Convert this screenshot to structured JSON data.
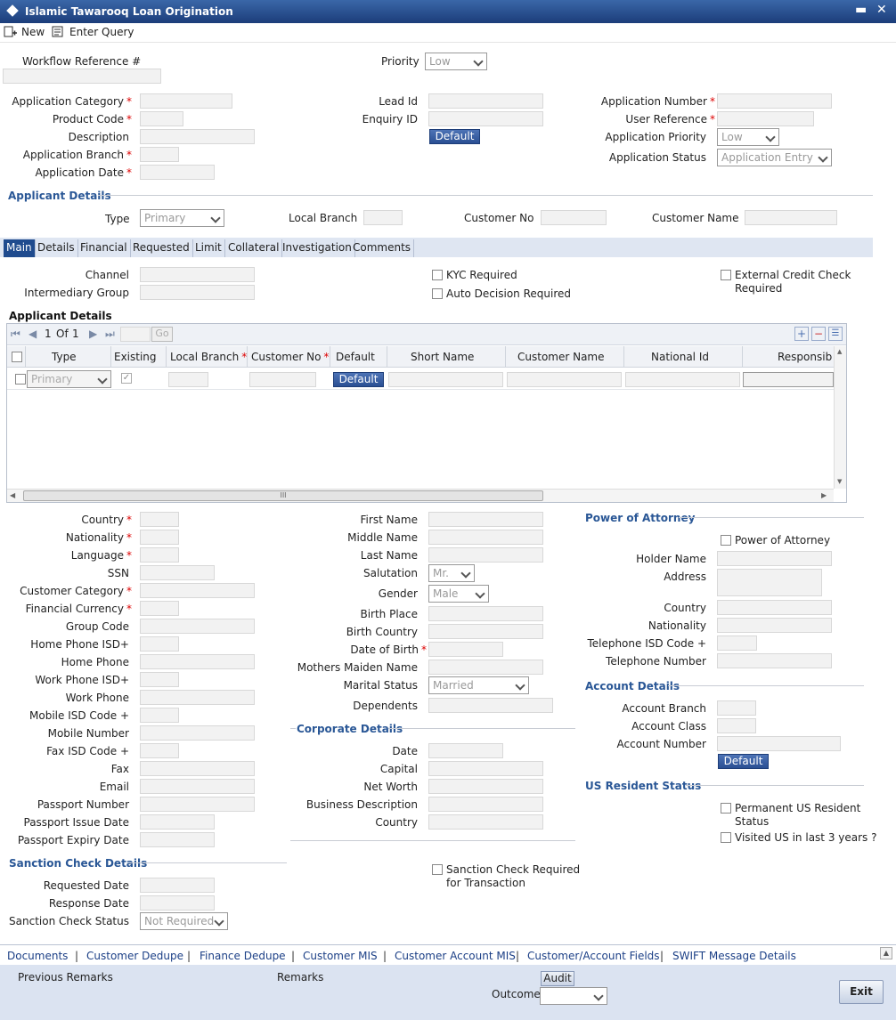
{
  "window": {
    "title": "Islamic Tawarooq Loan Origination",
    "min": "▬",
    "close": "✕"
  },
  "toolbar": {
    "new": "New",
    "enter_query": "Enter Query"
  },
  "header": {
    "workflow_ref": "Workflow Reference #",
    "priority": "Priority",
    "priority_val": "Low",
    "app_category": "Application Category",
    "product_code": "Product Code",
    "description": "Description",
    "app_branch": "Application Branch",
    "app_date": "Application Date",
    "lead_id": "Lead Id",
    "enquiry_id": "Enquiry ID",
    "default_btn": "Default",
    "app_number": "Application Number",
    "user_ref": "User Reference",
    "app_priority": "Application Priority",
    "app_priority_val": "Low",
    "app_status": "Application Status",
    "app_status_val": "Application Entry"
  },
  "applicant": {
    "section": "Applicant Details",
    "type": "Type",
    "type_val": "Primary",
    "local_branch": "Local Branch",
    "customer_no": "Customer No",
    "customer_name": "Customer Name"
  },
  "tabs": [
    "Main",
    "Details",
    "Financial",
    "Requested",
    "Limit",
    "Collateral",
    "Investigation",
    "Comments"
  ],
  "main": {
    "channel": "Channel",
    "intermediary": "Intermediary Group",
    "kyc": "KYC Required",
    "auto_decision": "Auto Decision Required",
    "ext_credit": "External Credit Check",
    "ext_credit2": "Required"
  },
  "grid": {
    "title": "Applicant Details",
    "page": "1",
    "of": "Of",
    "total": "1",
    "go": "Go",
    "cols": [
      "Type",
      "Existing",
      "Local Branch",
      "Customer No",
      "Default",
      "Short Name",
      "Customer Name",
      "National Id",
      "Responsib"
    ],
    "row_type": "Primary",
    "row_default": "Default",
    "scroll": "III"
  },
  "personal": {
    "country": "Country",
    "nationality": "Nationality",
    "language": "Language",
    "ssn": "SSN",
    "cust_category": "Customer Category",
    "fin_currency": "Financial Currency",
    "group_code": "Group Code",
    "home_isd": "Home Phone ISD+",
    "home_phone": "Home Phone",
    "work_isd": "Work Phone ISD+",
    "work_phone": "Work Phone",
    "mobile_isd": "Mobile ISD Code +",
    "mobile_number": "Mobile Number",
    "fax_isd": "Fax ISD Code +",
    "fax": "Fax",
    "email": "Email",
    "passport": "Passport Number",
    "passport_issue": "Passport Issue Date",
    "passport_expiry": "Passport Expiry Date"
  },
  "names": {
    "first": "First Name",
    "middle": "Middle Name",
    "last": "Last Name",
    "salutation": "Salutation",
    "salutation_val": "Mr.",
    "gender": "Gender",
    "gender_val": "Male",
    "birth_place": "Birth Place",
    "birth_country": "Birth Country",
    "dob": "Date of Birth",
    "mothers": "Mothers Maiden Name",
    "marital": "Marital Status",
    "marital_val": "Married",
    "dependents": "Dependents"
  },
  "corporate": {
    "section": "Corporate Details",
    "date": "Date",
    "capital": "Capital",
    "net_worth": "Net Worth",
    "business": "Business Description",
    "country": "Country"
  },
  "poa": {
    "section": "Power of Attorney",
    "check": "Power of Attorney",
    "holder": "Holder Name",
    "address": "Address",
    "country": "Country",
    "nationality": "Nationality",
    "tel_isd": "Telephone ISD Code +",
    "tel": "Telephone Number"
  },
  "account": {
    "section": "Account Details",
    "branch": "Account Branch",
    "class": "Account Class",
    "number": "Account Number",
    "default_btn": "Default"
  },
  "us": {
    "section": "US Resident Status",
    "perm": "Permanent US Resident",
    "perm2": "Status",
    "visited": "Visited US in last 3 years ?"
  },
  "sanction": {
    "section": "Sanction Check Details",
    "requested": "Requested Date",
    "response": "Response Date",
    "status": "Sanction Check Status",
    "status_val": "Not Required",
    "txn": "Sanction Check Required",
    "txn2": "for Transaction"
  },
  "footer_links": [
    "Documents",
    "Customer Dedupe",
    "Finance Dedupe",
    "Customer MIS",
    "Customer Account MIS",
    "Customer/Account Fields",
    "SWIFT Message Details"
  ],
  "footer": {
    "prev_remarks": "Previous Remarks",
    "remarks": "Remarks",
    "audit": "Audit",
    "outcome": "Outcome",
    "exit": "Exit"
  }
}
